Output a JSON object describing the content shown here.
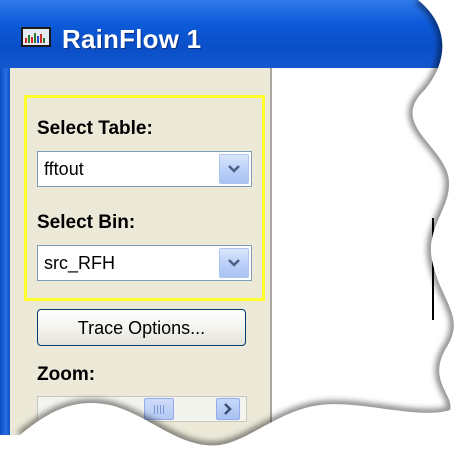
{
  "window": {
    "title": "RainFlow 1",
    "icon": "chart-window-icon"
  },
  "controls": {
    "select_table_label": "Select Table:",
    "table_value": "fftout",
    "select_bin_label": "Select Bin:",
    "bin_value": "src_RFH",
    "trace_options_label": "Trace Options...",
    "zoom_label": "Zoom:"
  },
  "colors": {
    "titlebar": "#0a4fc8",
    "panel": "#ece9d8",
    "highlight": "#ffff2e"
  }
}
